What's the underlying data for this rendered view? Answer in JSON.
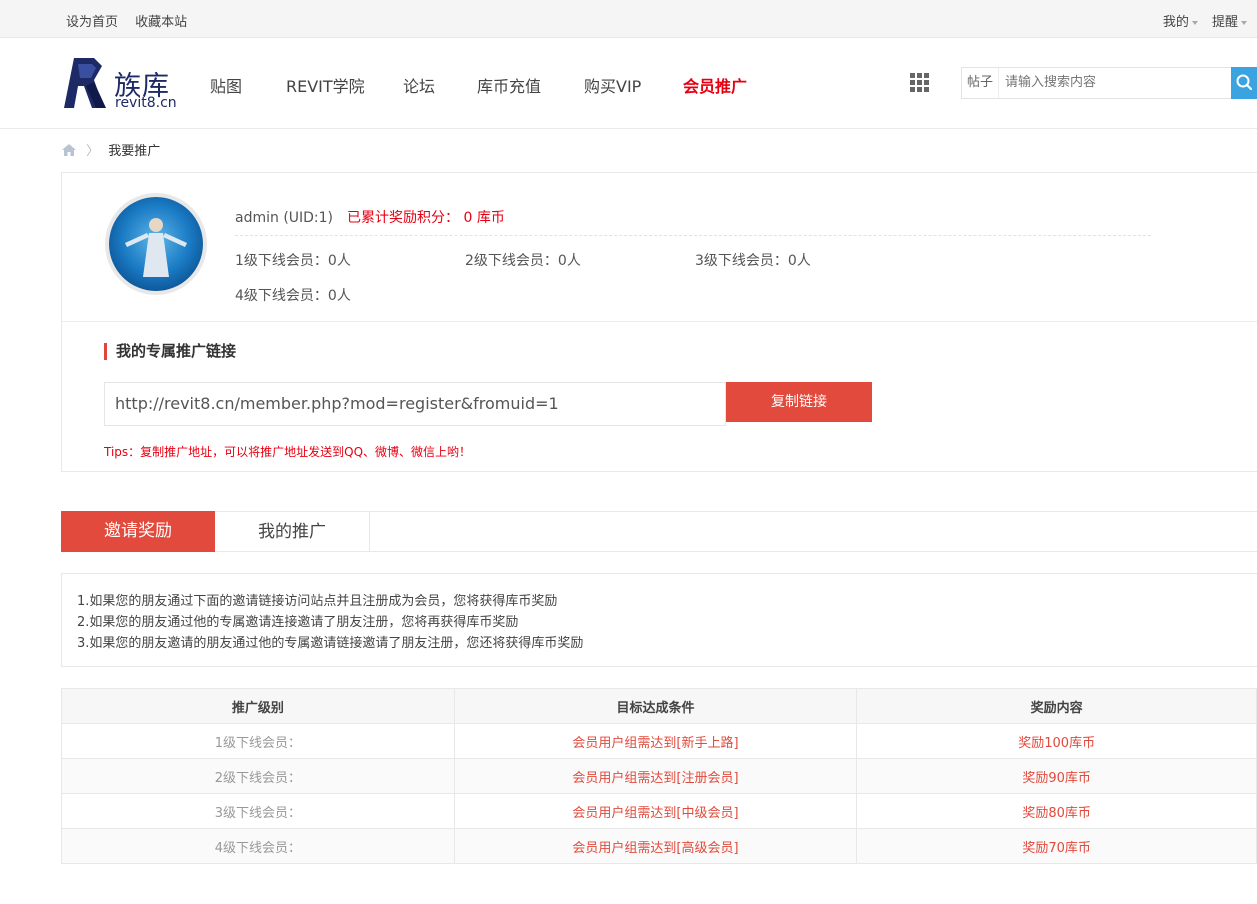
{
  "topbar": {
    "set_home": "设为首页",
    "bookmark": "收藏本站",
    "my": "我的",
    "remind": "提醒"
  },
  "header": {
    "logo_text": "族库",
    "logo_domain": "revit8.cn",
    "nav": [
      "贴图",
      "REVIT学院",
      "论坛",
      "库币充值",
      "购买VIP",
      "会员推广"
    ],
    "search_type": "帖子",
    "search_placeholder": "请输入搜索内容"
  },
  "breadcrumb": {
    "current": "我要推广"
  },
  "profile": {
    "username": "admin (UID:1)",
    "reward_text": "已累计奖励积分： 0 库币",
    "levels": [
      "1级下线会员：0人",
      "2级下线会员：0人",
      "3级下线会员：0人",
      "4级下线会员：0人"
    ]
  },
  "promo": {
    "title": "我的专属推广链接",
    "link": "http://revit8.cn/member.php?mod=register&fromuid=1",
    "copy_label": "复制链接",
    "tips": "Tips：复制推广地址，可以将推广地址发送到QQ、微博、微信上哟！"
  },
  "tabs": [
    "邀请奖励",
    "我的推广"
  ],
  "rules": [
    "1.如果您的朋友通过下面的邀请链接访问站点并且注册成为会员，您将获得库币奖励",
    "2.如果您的朋友通过他的专属邀请连接邀请了朋友注册，您将再获得库币奖励",
    "3.如果您的朋友邀请的朋友通过他的专属邀请链接邀请了朋友注册，您还将获得库币奖励"
  ],
  "table": {
    "headers": [
      "推广级别",
      "目标达成条件",
      "奖励内容"
    ],
    "rows": [
      [
        "1级下线会员：",
        "会员用户组需达到[新手上路]",
        "奖励100库币"
      ],
      [
        "2级下线会员：",
        "会员用户组需达到[注册会员]",
        "奖励90库币"
      ],
      [
        "3级下线会员：",
        "会员用户组需达到[中级会员]",
        "奖励80库币"
      ],
      [
        "4级下线会员：",
        "会员用户组需达到[高级会员]",
        "奖励70库币"
      ]
    ]
  },
  "colors": {
    "accent_red": "#e14a3c",
    "alert_red": "#e60012",
    "search_blue": "#3aa3e0",
    "brand_navy": "#1d2a66"
  },
  "icons": [
    "home-icon",
    "grid-icon",
    "search-icon",
    "chevron-down-icon",
    "avatar"
  ]
}
